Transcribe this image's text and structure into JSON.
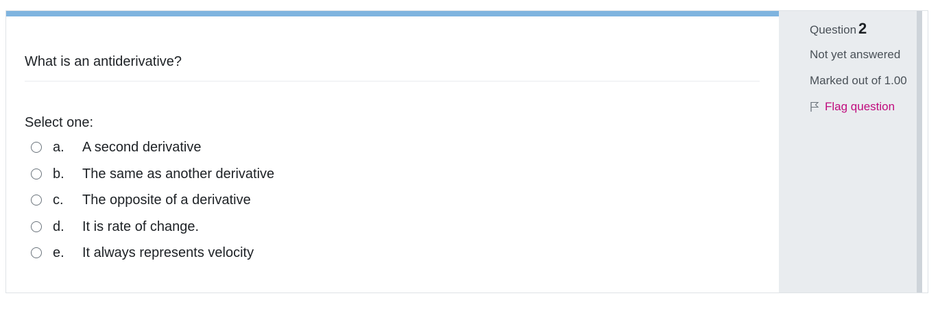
{
  "question": {
    "text": "What is an antiderivative?",
    "select_label": "Select one:",
    "options": [
      {
        "letter": "a.",
        "text": "A second derivative"
      },
      {
        "letter": "b.",
        "text": "The same as another derivative"
      },
      {
        "letter": "c.",
        "text": "The opposite of a derivative"
      },
      {
        "letter": "d.",
        "text": "It is rate of change."
      },
      {
        "letter": "e.",
        "text": "It always represents velocity"
      }
    ]
  },
  "info": {
    "question_label": "Question",
    "question_number": "2",
    "state": "Not yet answered",
    "grade": "Marked out of 1.00",
    "flag_label": "Flag question",
    "flag_icon": "flag-icon"
  },
  "colors": {
    "accent_bar": "#7fb4df",
    "flag": "#c00b7d",
    "panel_bg": "#e9ecef"
  }
}
